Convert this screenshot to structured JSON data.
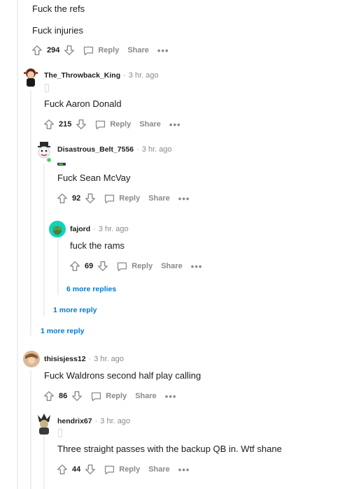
{
  "top_comment": {
    "lines": [
      "Fuck the refs",
      "Fuck injuries"
    ],
    "votes": "294",
    "reply_label": "Reply",
    "share_label": "Share",
    "more_label": "•••"
  },
  "comments": [
    {
      "username": "The_Throwback_King",
      "time": "3 hr. ago",
      "text": "Fuck Aaron Donald",
      "votes": "215"
    },
    {
      "username": "Disastrous_Belt_7556",
      "time": "3 hr. ago",
      "text": "Fuck Sean McVay",
      "votes": "92"
    },
    {
      "username": "fajord",
      "time": "3 hr. ago",
      "text": "fuck the rams",
      "votes": "69"
    },
    {
      "username": "thisisjess12",
      "time": "3 hr. ago",
      "text": "Fuck Waldrons second half play calling",
      "votes": "86"
    },
    {
      "username": "hendrix67",
      "time": "3 hr. ago",
      "text": "Three straight passes with the backup QB in. Wtf shane",
      "votes": "44"
    }
  ],
  "labels": {
    "reply": "Reply",
    "share": "Share",
    "more": "•••",
    "separator": "·"
  },
  "more_replies": {
    "six": "6 more replies",
    "one_inner": "1 more reply",
    "one_outer": "1 more reply"
  },
  "colors": {
    "link_blue": "#0079d3",
    "meta_gray": "#878a8c",
    "thread_line": "#edeff1",
    "online_green": "#46d160",
    "fajord_avatar": "#0dd3bb"
  }
}
